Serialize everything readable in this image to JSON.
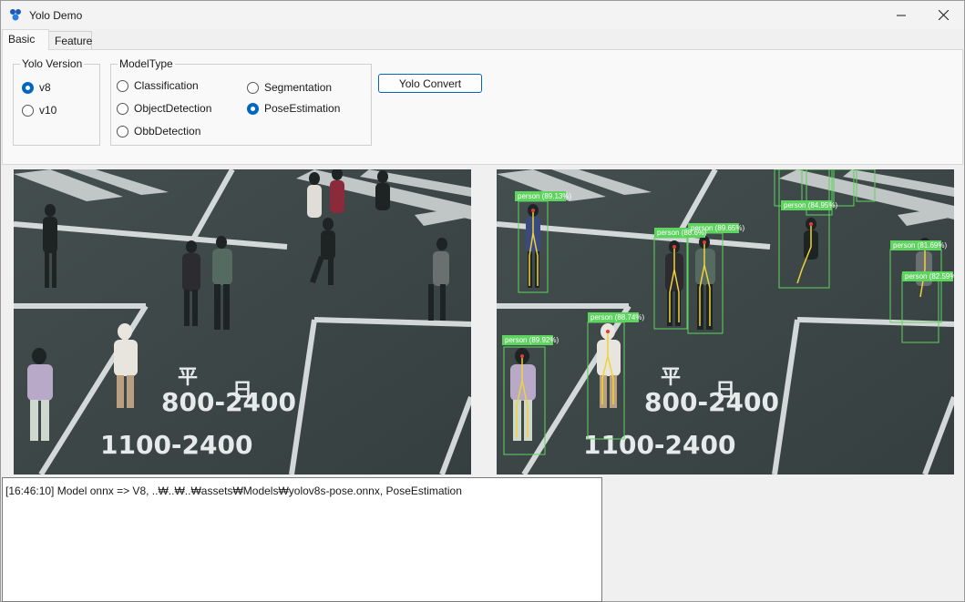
{
  "window": {
    "title": "Yolo Demo"
  },
  "tabs": [
    {
      "label": "Basic",
      "active": true
    },
    {
      "label": "Feature",
      "active": false
    }
  ],
  "yolo_version": {
    "legend": "Yolo Version",
    "options": [
      {
        "label": "v8",
        "checked": true
      },
      {
        "label": "v10",
        "checked": false
      }
    ]
  },
  "model_type": {
    "legend": "ModelType",
    "options": [
      {
        "label": "Classification",
        "checked": false
      },
      {
        "label": "ObjectDetection",
        "checked": false
      },
      {
        "label": "ObbDetection",
        "checked": false
      },
      {
        "label": "Segmentation",
        "checked": false
      },
      {
        "label": "PoseEstimation",
        "checked": true
      }
    ]
  },
  "convert_button": {
    "label": "Yolo Convert"
  },
  "images": {
    "street_markings": [
      "800-2400",
      "1100-2400"
    ],
    "detections": [
      {
        "label": "person (89.13%)"
      },
      {
        "label": "person (89.65%)"
      },
      {
        "label": "person (88.6%)"
      },
      {
        "label": "person (88.74%)"
      },
      {
        "label": "person (89.92%)"
      },
      {
        "label": "person (84.95%)"
      },
      {
        "label": "person (81.69%)"
      },
      {
        "label": "person (82.59%)"
      }
    ]
  },
  "log": {
    "lines": [
      "[16:46:10] Model onnx => V8, ..₩..₩..₩assets₩Models₩yolov8s-pose.onnx, PoseEstimation"
    ]
  },
  "colors": {
    "accent": "#0067c0",
    "detection_box": "#5fd35f",
    "road": "#3b4546"
  }
}
